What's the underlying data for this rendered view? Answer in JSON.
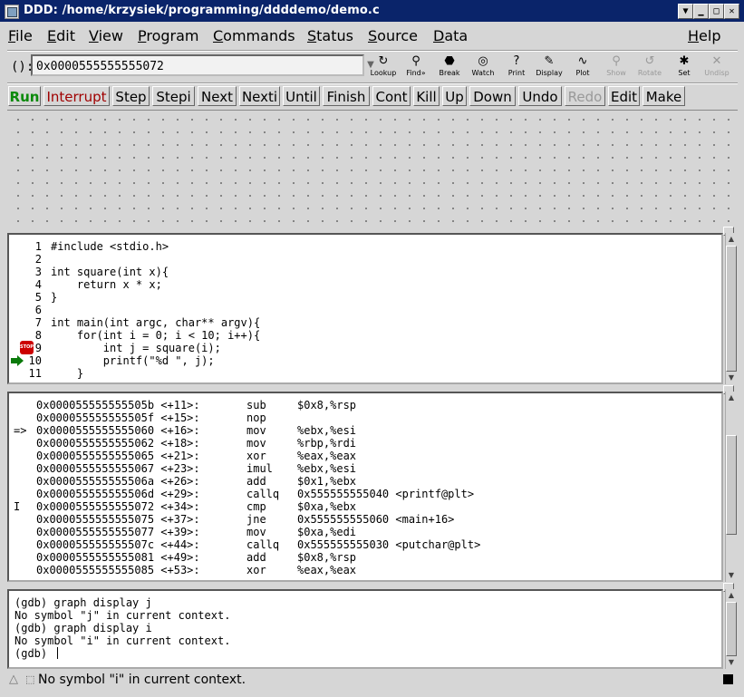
{
  "window": {
    "title": "DDD: /home/krzysiek/programming/ddddemo/demo.c"
  },
  "menubar": {
    "items": [
      {
        "label": "File",
        "key": "F",
        "rest": "ile"
      },
      {
        "label": "Edit",
        "key": "E",
        "rest": "dit"
      },
      {
        "label": "View",
        "key": "V",
        "rest": "iew"
      },
      {
        "label": "Program",
        "key": "P",
        "rest": "rogram"
      },
      {
        "label": "Commands",
        "key": "C",
        "rest": "ommands"
      },
      {
        "label": "Status",
        "key": "S",
        "rest": "tatus"
      },
      {
        "label": "Source",
        "key": "S",
        "rest": "ource"
      },
      {
        "label": "Data",
        "key": "D",
        "rest": "ata"
      },
      {
        "label": "Help",
        "key": "H",
        "rest": "elp"
      }
    ]
  },
  "argfield": {
    "label": "():",
    "value": "0x0000555555555072"
  },
  "toolbar": {
    "buttons": [
      {
        "label": "Lookup",
        "icon": "lookup-icon",
        "glyph": "↻"
      },
      {
        "label": "Find»",
        "icon": "find-icon",
        "glyph": "⚲"
      },
      {
        "label": "Break",
        "icon": "break-icon",
        "glyph": "⬣"
      },
      {
        "label": "Watch",
        "icon": "watch-icon",
        "glyph": "◎"
      },
      {
        "label": "Print",
        "icon": "print-icon",
        "glyph": "?"
      },
      {
        "label": "Display",
        "icon": "display-icon",
        "glyph": "✎"
      },
      {
        "label": "Plot",
        "icon": "plot-icon",
        "glyph": "∿"
      },
      {
        "label": "Show",
        "icon": "show-icon",
        "glyph": "⚲"
      },
      {
        "label": "Rotate",
        "icon": "rotate-icon",
        "glyph": "↺"
      },
      {
        "label": "Set",
        "icon": "set-icon",
        "glyph": "✱"
      },
      {
        "label": "Undisp",
        "icon": "undisp-icon",
        "glyph": "✕"
      }
    ]
  },
  "commands": {
    "buttons": [
      "Run",
      "Interrupt",
      "Step",
      "Stepi",
      "Next",
      "Nexti",
      "Until",
      "Finish",
      "Cont",
      "Kill",
      "Up",
      "Down",
      "Undo",
      "Redo",
      "Edit",
      "Make"
    ]
  },
  "source": {
    "lines": [
      {
        "num": "1",
        "code": "#include <stdio.h>"
      },
      {
        "num": "2",
        "code": ""
      },
      {
        "num": "3",
        "code": "int square(int x){"
      },
      {
        "num": "4",
        "code": "    return x * x;"
      },
      {
        "num": "5",
        "code": "}"
      },
      {
        "num": "6",
        "code": ""
      },
      {
        "num": "7",
        "code": "int main(int argc, char** argv){"
      },
      {
        "num": "8",
        "code": "    for(int i = 0; i < 10; i++){"
      },
      {
        "num": "9",
        "code": "        int j = square(i);"
      },
      {
        "num": "10",
        "code": "        printf(\"%d \", j);"
      },
      {
        "num": "11",
        "code": "    }"
      }
    ],
    "breakpoint_label": "STOP"
  },
  "assembly": {
    "lines": [
      {
        "mark": "",
        "addr": "0x000055555555505b <+11>:",
        "mn": "sub",
        "op": "$0x8,%rsp"
      },
      {
        "mark": "",
        "addr": "0x000055555555505f <+15>:",
        "mn": "nop",
        "op": ""
      },
      {
        "mark": "=>",
        "addr": "0x0000555555555060 <+16>:",
        "mn": "mov",
        "op": "%ebx,%esi"
      },
      {
        "mark": "",
        "addr": "0x0000555555555062 <+18>:",
        "mn": "mov",
        "op": "%rbp,%rdi"
      },
      {
        "mark": "",
        "addr": "0x0000555555555065 <+21>:",
        "mn": "xor",
        "op": "%eax,%eax"
      },
      {
        "mark": "",
        "addr": "0x0000555555555067 <+23>:",
        "mn": "imul",
        "op": "%ebx,%esi"
      },
      {
        "mark": "",
        "addr": "0x000055555555506a <+26>:",
        "mn": "add",
        "op": "$0x1,%ebx"
      },
      {
        "mark": "",
        "addr": "0x000055555555506d <+29>:",
        "mn": "callq",
        "op": "0x555555555040 <printf@plt>"
      },
      {
        "mark": "I",
        "addr": "0x0000555555555072 <+34>:",
        "mn": "cmp",
        "op": "$0xa,%ebx"
      },
      {
        "mark": "",
        "addr": "0x0000555555555075 <+37>:",
        "mn": "jne",
        "op": "0x555555555060 <main+16>"
      },
      {
        "mark": "",
        "addr": "0x0000555555555077 <+39>:",
        "mn": "mov",
        "op": "$0xa,%edi"
      },
      {
        "mark": "",
        "addr": "0x000055555555507c <+44>:",
        "mn": "callq",
        "op": "0x555555555030 <putchar@plt>"
      },
      {
        "mark": "",
        "addr": "0x0000555555555081 <+49>:",
        "mn": "add",
        "op": "$0x8,%rsp"
      },
      {
        "mark": "",
        "addr": "0x0000555555555085 <+53>:",
        "mn": "xor",
        "op": "%eax,%eax"
      }
    ]
  },
  "console": {
    "lines": [
      "(gdb) graph display j",
      "No symbol \"j\" in current context.",
      "(gdb) graph display i",
      "No symbol \"i\" in current context.",
      "(gdb) "
    ]
  },
  "status": {
    "text": "No symbol \"i\" in current context."
  }
}
